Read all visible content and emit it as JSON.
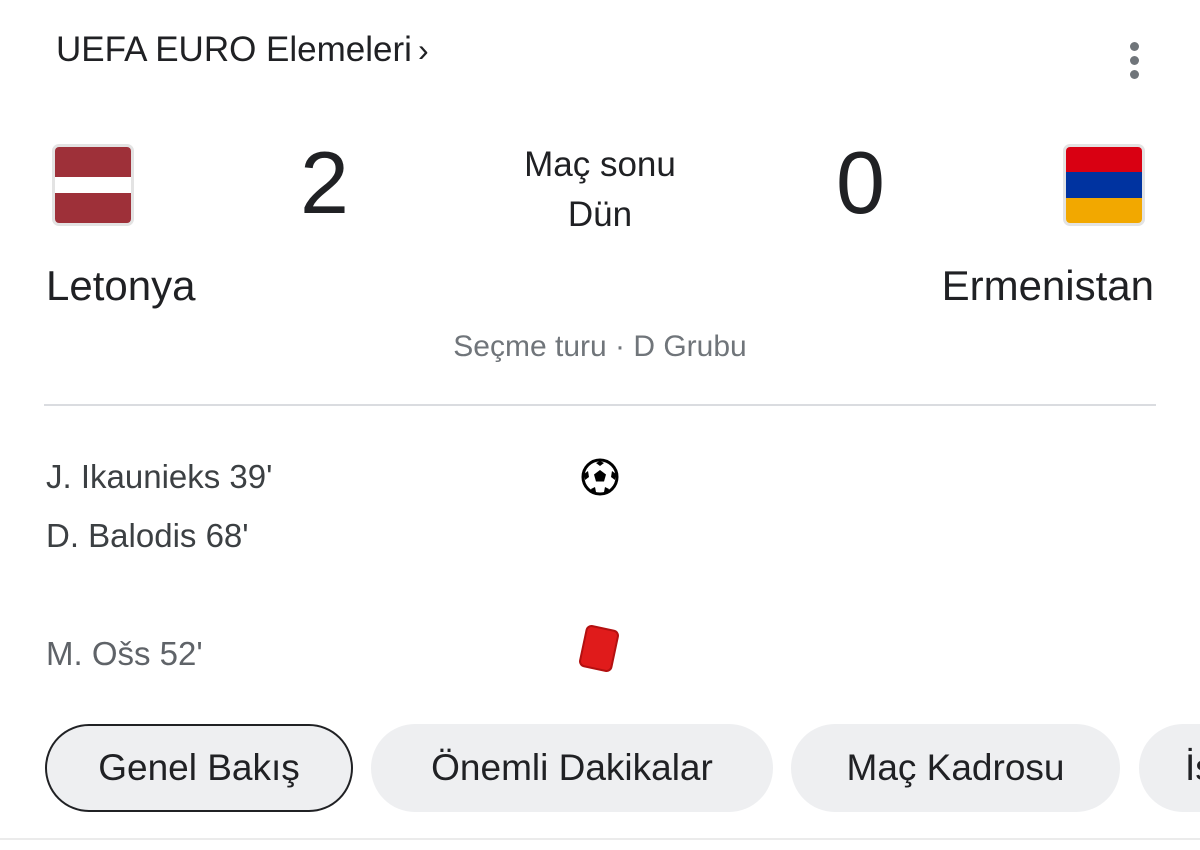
{
  "header": {
    "league": "UEFA EURO Elemeleri",
    "chevron": "›",
    "menu_icon": "more-vert-icon"
  },
  "match": {
    "home": {
      "name": "Letonya",
      "score": "2",
      "flag_colors": [
        "#9e3039",
        "#ffffff",
        "#9e3039"
      ]
    },
    "away": {
      "name": "Ermenistan",
      "score": "0",
      "flag_colors": [
        "#d90012",
        "#0033a0",
        "#f2a800"
      ]
    },
    "status": "Maç sonu",
    "date": "Dün",
    "round": "Seçme turu · D Grubu"
  },
  "events": {
    "goals": [
      "J. Ikaunieks 39'",
      "D. Balodis 68'"
    ],
    "goal_icon": "soccer-ball-icon",
    "red_cards": [
      "M. Ošs 52'"
    ],
    "red_card_icon": "red-card-icon"
  },
  "tabs": [
    {
      "label": "Genel Bakış",
      "active": true
    },
    {
      "label": "Önemli Dakikalar",
      "active": false
    },
    {
      "label": "Maç Kadrosu",
      "active": false
    },
    {
      "label": "İs",
      "active": false
    }
  ]
}
